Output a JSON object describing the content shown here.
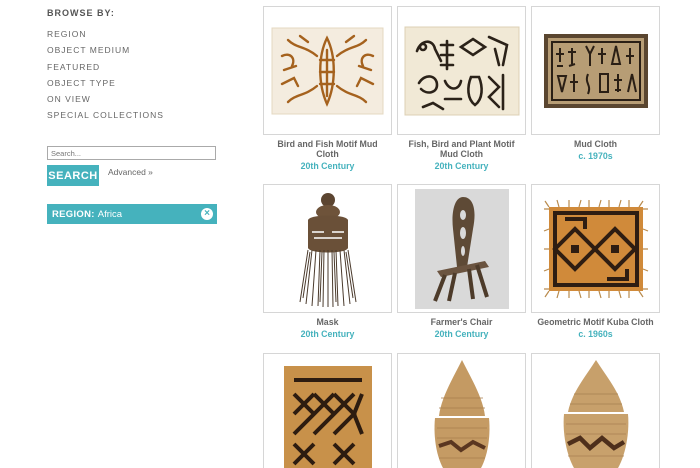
{
  "sidebar": {
    "browse_title": "BROWSE BY:",
    "items": [
      {
        "label": "REGION"
      },
      {
        "label": "OBJECT MEDIUM"
      },
      {
        "label": "FEATURED"
      },
      {
        "label": "OBJECT TYPE"
      },
      {
        "label": "ON VIEW"
      },
      {
        "label": "SPECIAL COLLECTIONS"
      }
    ]
  },
  "search": {
    "placeholder": "Search...",
    "value": "",
    "button_label": "SEARCH",
    "advanced_label": "Advanced »"
  },
  "filter": {
    "key": "REGION:",
    "value": "Africa",
    "close_icon": "close-circle-icon"
  },
  "items": [
    {
      "title": "Bird and Fish Motif Mud Cloth",
      "date": "20th Century",
      "image": "mud-cloth-birds-fish"
    },
    {
      "title": "Fish, Bird and Plant Motif Mud Cloth",
      "date": "20th Century",
      "image": "mud-cloth-fish-bird-plant"
    },
    {
      "title": "Mud Cloth",
      "date": "c. 1970s",
      "image": "mud-cloth-figures"
    },
    {
      "title": "Mask",
      "date": "20th Century",
      "image": "fiber-mask"
    },
    {
      "title": "Farmer's Chair",
      "date": "20th Century",
      "image": "wooden-chair"
    },
    {
      "title": "Geometric Motif Kuba Cloth",
      "date": "c. 1960s",
      "image": "kuba-cloth"
    },
    {
      "title": "",
      "date": "",
      "image": "woven-mat"
    },
    {
      "title": "",
      "date": "",
      "image": "lidded-basket"
    },
    {
      "title": "",
      "date": "",
      "image": "lidded-basket-2"
    }
  ],
  "colors": {
    "accent": "#45b2bd",
    "text": "#666666"
  }
}
